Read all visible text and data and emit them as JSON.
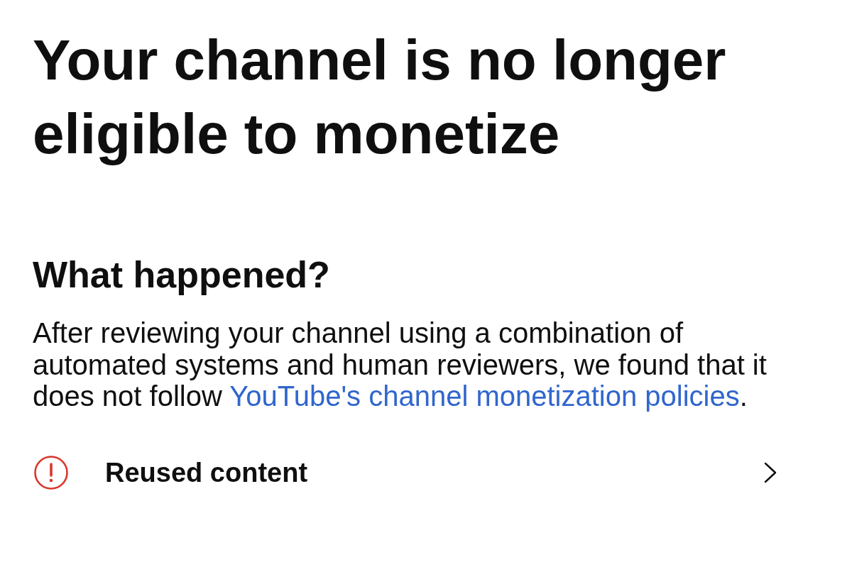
{
  "title": "Your channel is no longer eligible to monetize",
  "section": {
    "heading": "What happened?",
    "body": {
      "before": "After reviewing your channel using a combination of automated systems and human reviewers, we found that it does not follow",
      "link": "YouTube's channel monetization policies",
      "after": "."
    }
  },
  "reasons": [
    {
      "label": "Reused content"
    }
  ]
}
